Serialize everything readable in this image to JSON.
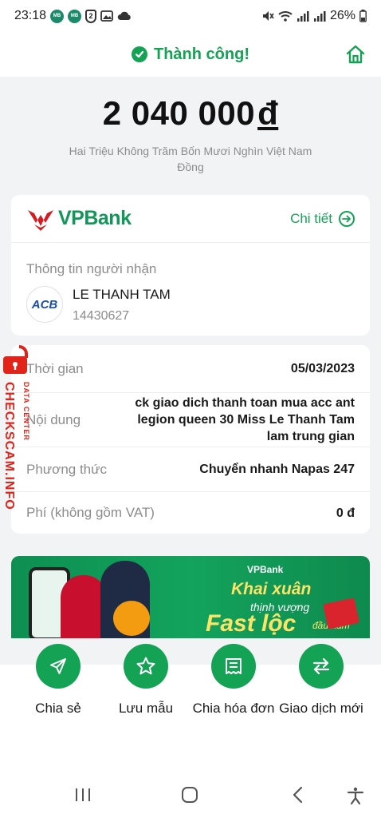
{
  "status_bar": {
    "time": "23:18",
    "app_badge_1": "MB",
    "app_badge_2": "MB",
    "shield_badge": "2",
    "battery": "26%"
  },
  "header": {
    "title": "Thành công!",
    "accent_color": "#14a354"
  },
  "summary": {
    "amount": "2 040 000",
    "currency_symbol": "đ",
    "amount_words": "Hai Triệu Không Trăm Bốn Mươi Nghìn Việt Nam Đồng"
  },
  "bank_card": {
    "bank_name": "VPBank",
    "detail_link": "Chi tiết",
    "recipient_label": "Thông tin người nhận",
    "recipient_bank_logo": "ACB",
    "recipient_name": "LE THANH TAM",
    "recipient_account": "14430627"
  },
  "details": [
    {
      "label": "Thời gian",
      "value": "05/03/2023"
    },
    {
      "label": "Nội dung",
      "value": "ck giao dich thanh toan mua acc ant legion queen 30 Miss Le Thanh Tam lam trung gian"
    },
    {
      "label": "Phương thức",
      "value": "Chuyển nhanh Napas 247"
    },
    {
      "label": "Phí (không gồm VAT)",
      "value": "0 đ"
    }
  ],
  "banner": {
    "logo": "VPBank",
    "line1": "Khai xuân",
    "line2": "thịnh vượng",
    "line3": "Fast lộc",
    "line4": "đầu năm"
  },
  "watermark": {
    "main": "CHECKSCAM.INFO",
    "sub": "DATA CENTER"
  },
  "actions": [
    {
      "label": "Chia sẻ",
      "icon": "send-icon"
    },
    {
      "label": "Lưu mẫu",
      "icon": "star-icon"
    },
    {
      "label": "Chia hóa đơn",
      "icon": "receipt-icon"
    },
    {
      "label": "Giao dịch mới",
      "icon": "swap-icon"
    }
  ],
  "nav": [
    "recent-apps-icon",
    "home-circle-icon",
    "back-icon",
    "accessibility-icon"
  ]
}
